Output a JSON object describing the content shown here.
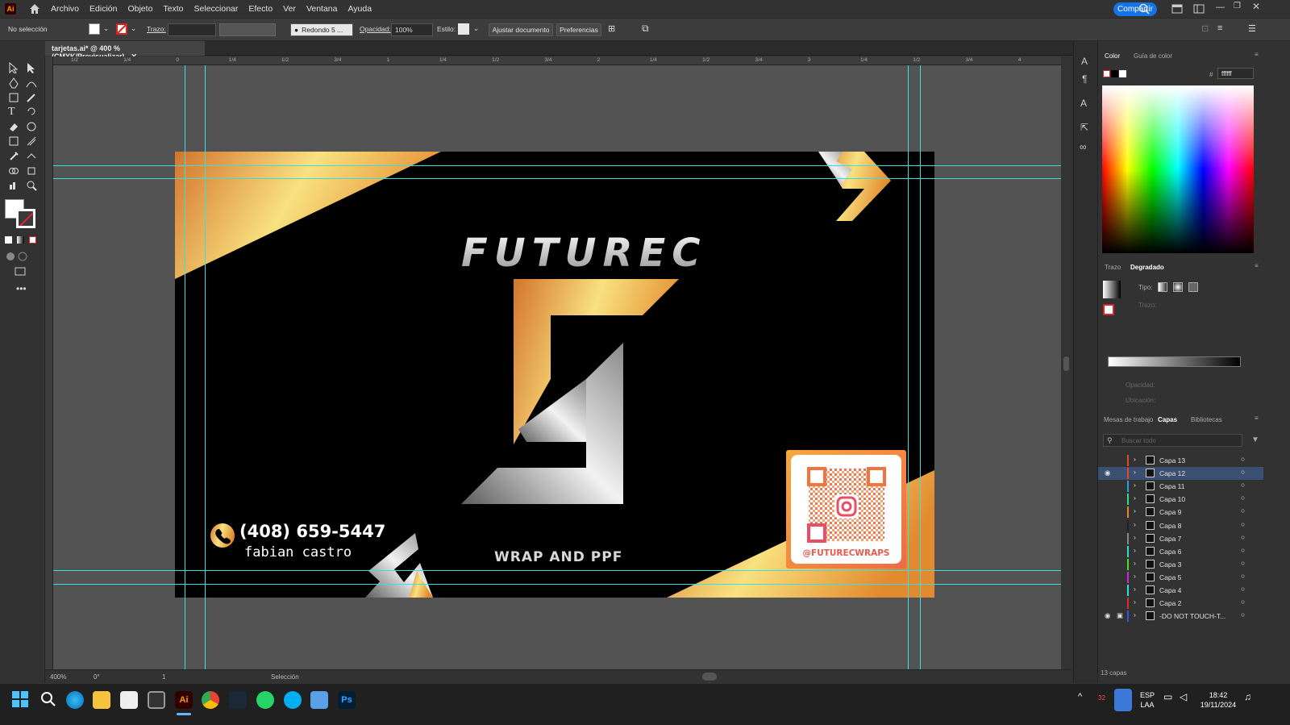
{
  "app": {
    "logo": "Ai",
    "menu": [
      "Archivo",
      "Edición",
      "Objeto",
      "Texto",
      "Seleccionar",
      "Efecto",
      "Ver",
      "Ventana",
      "Ayuda"
    ],
    "share_label": "Compartir"
  },
  "control": {
    "selection": "No selección",
    "stroke_label": "Trazo:",
    "brush": "Redondo 5 ...",
    "opacity_label": "Opacidad:",
    "opacity_value": "100%",
    "style_label": "Estilo:",
    "fit_btn": "Ajustar documento",
    "prefs_btn": "Preferencias"
  },
  "doc": {
    "tab_title": "tarjetas.ai* @ 400 % (CMYK/Previsualizar)",
    "ruler_marks": [
      "1/2",
      "1/4",
      "0",
      "1/4",
      "1/2",
      "3/4",
      "1",
      "1/4",
      "1/2",
      "3/4",
      "2",
      "1/4",
      "1/2",
      "3/4",
      "3",
      "1/4",
      "1/2",
      "3/4",
      "4"
    ]
  },
  "card": {
    "brand": "FUTUREC",
    "phone": "(408) 659-5447",
    "name": "fabian castro",
    "tagline": "WRAP AND PPF",
    "handle": "@FUTURECWRAPS"
  },
  "status": {
    "zoom": "400%",
    "rotate": "0°",
    "artboard": "1",
    "mode": "Selección"
  },
  "color_panel": {
    "tab_color": "Color",
    "tab_guide": "Guía de color",
    "hex": "ffffff"
  },
  "gradient_panel": {
    "tab_stroke": "Trazo",
    "tab_gradient": "Degradado",
    "type_label": "Tipo:",
    "stroke_label": "Trazo:",
    "opacity_label": "Opacidad:",
    "location_label": "Ubicación:"
  },
  "layers_panel": {
    "tab_artboards": "Mesas de trabajo",
    "tab_layers": "Capas",
    "tab_libraries": "Bibliotecas",
    "search_placeholder": "Buscar todo",
    "count": "13 capas",
    "layers": [
      {
        "name": "Capa 13",
        "color": "#e04a2a",
        "visible": false,
        "locked": false,
        "selected": false
      },
      {
        "name": "Capa 12",
        "color": "#e04a2a",
        "visible": true,
        "locked": false,
        "selected": true
      },
      {
        "name": "Capa 11",
        "color": "#2aa0e0",
        "visible": false,
        "locked": false,
        "selected": false
      },
      {
        "name": "Capa 10",
        "color": "#2ae08a",
        "visible": false,
        "locked": false,
        "selected": false
      },
      {
        "name": "Capa 9",
        "color": "#e0892a",
        "visible": false,
        "locked": false,
        "selected": false
      },
      {
        "name": "Capa 8",
        "color": "#222222",
        "visible": false,
        "locked": false,
        "selected": false
      },
      {
        "name": "Capa 7",
        "color": "#888888",
        "visible": false,
        "locked": false,
        "selected": false
      },
      {
        "name": "Capa 6",
        "color": "#2ae0c8",
        "visible": false,
        "locked": false,
        "selected": false
      },
      {
        "name": "Capa 3",
        "color": "#4ae02a",
        "visible": false,
        "locked": false,
        "selected": false
      },
      {
        "name": "Capa 5",
        "color": "#c82ae0",
        "visible": false,
        "locked": false,
        "selected": false
      },
      {
        "name": "Capa 4",
        "color": "#2ae0e0",
        "visible": false,
        "locked": false,
        "selected": false
      },
      {
        "name": "Capa 2",
        "color": "#e02a2a",
        "visible": false,
        "locked": false,
        "selected": false
      },
      {
        "name": "-DO NOT TOUCH-T...",
        "color": "#2a5ae0",
        "visible": true,
        "locked": true,
        "selected": false
      }
    ]
  },
  "taskbar": {
    "lang_top": "ESP",
    "lang_bottom": "LAA",
    "time": "18:42",
    "date": "19/11/2024",
    "badge": "32"
  }
}
